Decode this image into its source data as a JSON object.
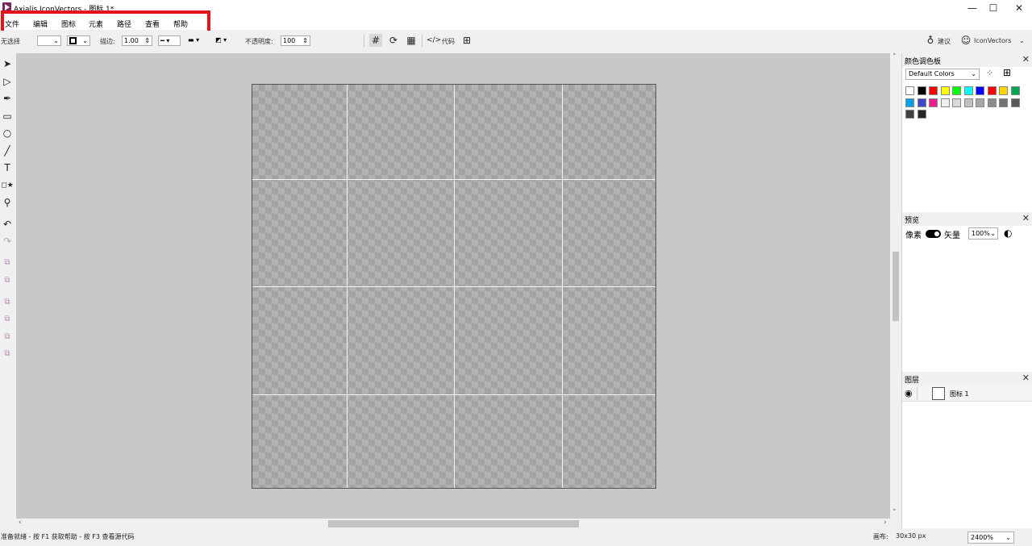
{
  "window": {
    "title": "Axialis IconVectors - 图标 1*",
    "minimize": "—",
    "maximize": "☐",
    "close": "✕"
  },
  "menu": [
    "文件",
    "编辑",
    "图标",
    "元素",
    "路径",
    "查看",
    "帮助"
  ],
  "toolbar": {
    "selection_label": "无选择",
    "stroke_label": "描边:",
    "stroke_value": "1.00",
    "opacity_label": "不透明度:",
    "opacity_value": "100",
    "code_label": "代码",
    "suggest_label": "建议",
    "account_label": "IconVectors"
  },
  "tools": [
    "select-arrow",
    "direct-select",
    "pen",
    "rectangle",
    "ellipse",
    "line",
    "text",
    "shapes",
    "zoom",
    "undo",
    "redo"
  ],
  "canvas": {
    "grid_divisions": [
      0.233,
      0.5,
      0.767
    ],
    "zoom": "2400%"
  },
  "panels": {
    "palette": {
      "title": "颜色调色板",
      "selected": "Default Colors",
      "swatches": [
        "#ffffff",
        "#000000",
        "#ff0000",
        "#ffff00",
        "#00ff00",
        "#00ffff",
        "#0000ff",
        "#ff0000",
        "#ffd700",
        "#00a651",
        "#00a2e8",
        "#3f48cc",
        "#ed1c8f",
        "#f0f0f0",
        "#d9d9d9",
        "#c0c0c0",
        "#a6a6a6",
        "#8c8c8c",
        "#737373",
        "#595959",
        "#404040",
        "#262626"
      ]
    },
    "preview": {
      "title": "预览",
      "pixel_label": "像素",
      "vector_label": "矢量",
      "zoom": "100%"
    },
    "layers": {
      "title": "图层",
      "items": [
        "图标 1"
      ]
    }
  },
  "status": {
    "left": "准备就绪 - 按 F1 获取帮助 - 按 F3 查看源代码",
    "canvas_label": "画布:",
    "canvas_value": "30x30 px",
    "zoom": "2400%"
  }
}
